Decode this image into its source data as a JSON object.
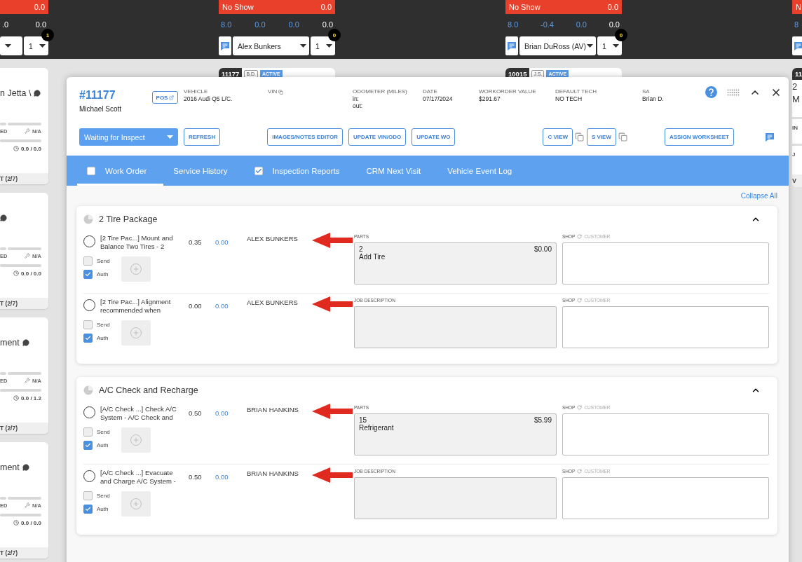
{
  "board": {
    "columns": [
      {
        "status": {
          "value": "0.0"
        },
        "numbers": [
          {
            "text": ".0",
            "kind": "total"
          },
          {
            "text": "0.0",
            "kind": "total"
          }
        ],
        "chat": false,
        "selects": [
          {
            "kind": "tech"
          },
          {
            "kind": "count",
            "value": "1"
          }
        ],
        "badge": "1",
        "cards": [
          {
            "kind": "summary",
            "title": "n Jetta \\",
            "comment": true,
            "left_label": "ED",
            "right_label": "N/A",
            "hours": "0.0 / 0.0",
            "footer": "T (2/7)"
          },
          {
            "kind": "summary",
            "comment": true,
            "left_label": "ED",
            "right_label": "N/A",
            "hours": "0.0 / 0.0",
            "footer": "T (2/7)"
          },
          {
            "kind": "summary",
            "title": "ment",
            "comment": true,
            "left_label": "ED",
            "right_label": "N/A",
            "hours": "0.0 / 1.2",
            "footer": "T (2/7)"
          },
          {
            "kind": "summary",
            "title": "ment",
            "comment": true,
            "left_label": "ED",
            "right_label": "N/A",
            "hours": "0.0 / 0.0",
            "footer": "T (2/7)"
          }
        ]
      },
      {
        "status": {
          "label": "No Show",
          "value": "0.0"
        },
        "numbers": [
          {
            "text": "8.0",
            "kind": "planned"
          },
          {
            "text": "0.0",
            "kind": "planned"
          },
          {
            "text": "0.0",
            "kind": "planned"
          },
          {
            "text": "0.0",
            "kind": "total"
          }
        ],
        "chat": true,
        "selects": [
          {
            "kind": "tech",
            "value": "Alex Bunkers"
          },
          {
            "kind": "count",
            "value": "1"
          }
        ],
        "badge": "0",
        "cards": [
          {
            "kind": "tag",
            "number": "11177",
            "initials": "B.D.",
            "status": "ACTIVE"
          }
        ]
      },
      {
        "status": {
          "label": "No Show",
          "value": "0.0"
        },
        "numbers": [
          {
            "text": "8.0",
            "kind": "planned"
          },
          {
            "text": "-0.4",
            "kind": "planned"
          },
          {
            "text": "0.0",
            "kind": "planned"
          },
          {
            "text": "0.0",
            "kind": "total"
          }
        ],
        "chat": true,
        "selects": [
          {
            "kind": "tech",
            "value": "Brian DuRoss (AV)"
          },
          {
            "kind": "count",
            "value": "1"
          }
        ],
        "badge": "0",
        "cards": [
          {
            "kind": "tag",
            "number": "10015",
            "initials": "J.S.",
            "status": "ACTIVE"
          }
        ]
      },
      {
        "status": {
          "label": "N"
        },
        "numbers": [
          {
            "text": "8",
            "kind": "planned"
          }
        ],
        "chat": true,
        "cards": [
          {
            "kind": "detail",
            "number": "11",
            "lines": [
              {
                "kind": "title",
                "text": "2"
              },
              {
                "kind": "title",
                "text": "M"
              },
              {
                "kind": "label",
                "text": "IN"
              },
              {
                "kind": "label",
                "text": "J"
              }
            ],
            "footer": "V"
          }
        ]
      }
    ]
  },
  "work_order": {
    "number": "#11177",
    "customer": "Michael Scott",
    "pos": "POS",
    "fields": [
      {
        "label": "VEHICLE",
        "lines": [
          "2016 Audi Q5 L/C."
        ]
      },
      {
        "label": "VIN",
        "copy": true
      },
      {
        "label": "ODOMETER (MILES)",
        "lines": [
          "in:",
          "out:"
        ]
      },
      {
        "label": "DATE",
        "lines": [
          "07/17/2024"
        ]
      },
      {
        "label": "WORKORDER VALUE",
        "lines": [
          "$291.67"
        ]
      },
      {
        "label": "DEFAULT TECH",
        "lines": [
          "NO TECH"
        ]
      },
      {
        "label": "SA",
        "lines": [
          "Brian D."
        ]
      }
    ],
    "status_select": "Waiting for Inspect",
    "buttons": [
      {
        "label": "REFRESH"
      },
      {
        "label": "IMAGES/NOTES EDITOR"
      },
      {
        "label": "UPDATE VIN/ODO"
      },
      {
        "label": "UPDATE WO"
      },
      {
        "label": "C VIEW",
        "copy": true
      },
      {
        "label": "S VIEW",
        "copy": true
      },
      {
        "label": "ASSIGN WORKSHEET"
      }
    ]
  },
  "tabs": [
    {
      "label": "Work Order",
      "selected": true,
      "checked": false
    },
    {
      "label": "Service History",
      "selected": false
    },
    {
      "label": "Inspection Reports",
      "selected": false,
      "checked": true
    },
    {
      "label": "CRM Next Visit",
      "selected": false
    },
    {
      "label": "Vehicle Event Log",
      "selected": false
    }
  ],
  "collapse_all": "Collapse All",
  "groups": [
    {
      "title": "2 Tire Package",
      "expanded": true,
      "services": [
        {
          "selected": false,
          "description": "[2 Tire Pac...] Mount and Balance Two Tires - 2",
          "hours": "0.35",
          "price": "0.00",
          "tech": "ALEX BUNKERS",
          "annotated": true,
          "options": [
            {
              "label": "Send",
              "checked": false
            },
            {
              "label": "Auth",
              "checked": true
            }
          ],
          "panel": {
            "kind": "parts",
            "label": "PARTS",
            "qty": "2",
            "amount": "$0.00",
            "name": "Add Tire"
          },
          "shop": "SHOP",
          "customer": "CUSTOMER"
        },
        {
          "selected": false,
          "description": "[2 Tire Pac...] Alignment recommended when",
          "hours": "0.00",
          "price": "0.00",
          "tech": "ALEX BUNKERS",
          "annotated": true,
          "options": [
            {
              "label": "Send",
              "checked": false
            },
            {
              "label": "Auth",
              "checked": true
            }
          ],
          "panel": {
            "kind": "description",
            "label": "JOB DESCRIPTION"
          },
          "shop": "SHOP",
          "customer": "CUSTOMER"
        }
      ]
    },
    {
      "title": "A/C Check and Recharge",
      "expanded": true,
      "services": [
        {
          "selected": false,
          "description": "[A/C Check ...] Check A/C System - A/C Check and",
          "hours": "0.50",
          "price": "0.00",
          "tech": "BRIAN HANKINS",
          "annotated": true,
          "options": [
            {
              "label": "Send",
              "checked": false
            },
            {
              "label": "Auth",
              "checked": true
            }
          ],
          "panel": {
            "kind": "parts",
            "label": "PARTS",
            "qty": "15",
            "amount": "$5.99",
            "name": "Refrigerant"
          },
          "shop": "SHOP",
          "customer": "CUSTOMER"
        },
        {
          "selected": false,
          "description": "[A/C Check ...] Evacuate and Charge A/C System -",
          "hours": "0.50",
          "price": "0.00",
          "tech": "BRIAN HANKINS",
          "annotated": true,
          "options": [
            {
              "label": "Send",
              "checked": false
            },
            {
              "label": "Auth",
              "checked": true
            }
          ],
          "panel": {
            "kind": "description",
            "label": "JOB DESCRIPTION"
          },
          "shop": "SHOP",
          "customer": "CUSTOMER"
        }
      ]
    }
  ]
}
